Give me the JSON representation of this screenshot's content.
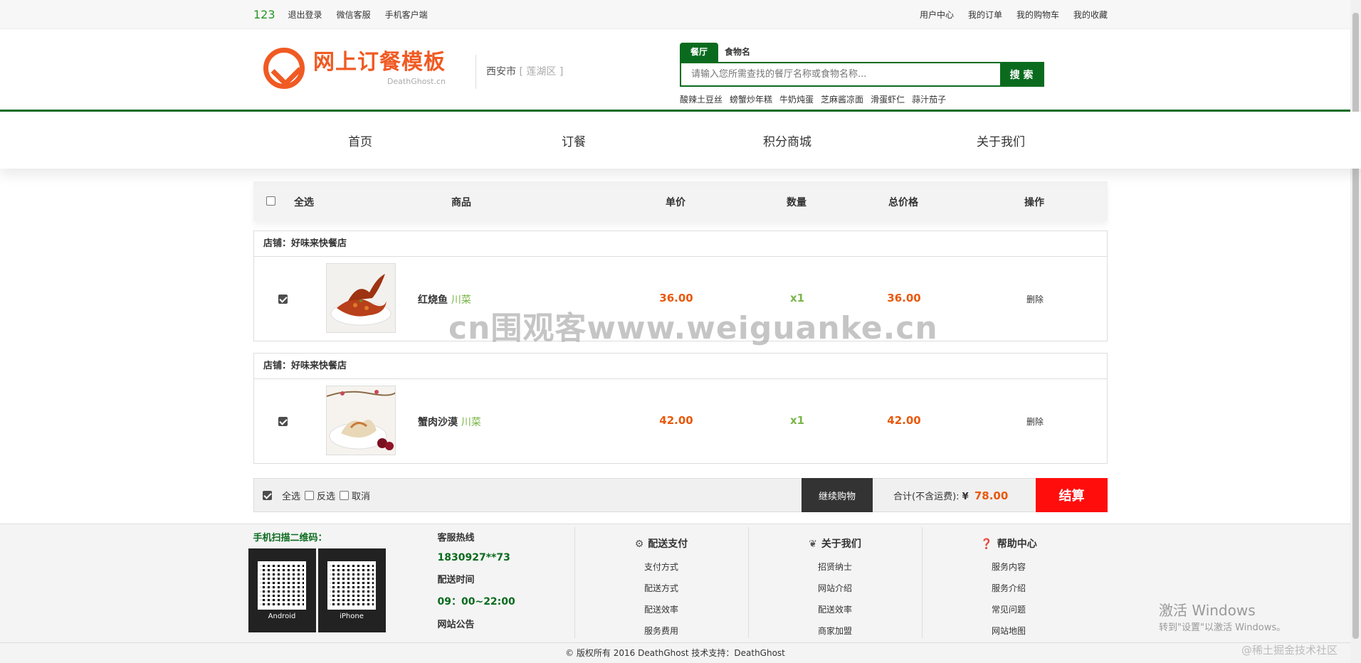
{
  "topbar": {
    "username": "123",
    "left_links": [
      "退出登录",
      "微信客服",
      "手机客户端"
    ],
    "right_links": [
      "用户中心",
      "我的订单",
      "我的购物车",
      "我的收藏"
    ]
  },
  "header": {
    "logo_cn": "网上订餐模板",
    "logo_en": "DeathGhost.cn",
    "city": "西安市",
    "district": "[ 莲湖区 ]",
    "search_tabs": [
      "餐厅",
      "食物名"
    ],
    "search_placeholder": "请输入您所需查找的餐厅名称或食物名称...",
    "search_button": "搜 索",
    "hot_keywords": [
      "酸辣土豆丝",
      "螃蟹炒年糕",
      "牛奶炖蛋",
      "芝麻酱凉面",
      "滑蛋虾仁",
      "蒜汁茄子"
    ]
  },
  "nav": [
    "首页",
    "订餐",
    "积分商城",
    "关于我们"
  ],
  "cart": {
    "headers": {
      "select_all": "全选",
      "product": "商品",
      "unit_price": "单价",
      "quantity": "数量",
      "total": "总价格",
      "action": "操作"
    },
    "shops": [
      {
        "title": "店铺：好味来快餐店",
        "item": {
          "name": "红烧鱼",
          "tag": "川菜",
          "price": "36.00",
          "qty": "x1",
          "total": "36.00",
          "action": "删除"
        }
      },
      {
        "title": "店铺：好味来快餐店",
        "item": {
          "name": "蟹肉沙漠",
          "tag": "川菜",
          "price": "42.00",
          "qty": "x1",
          "total": "42.00",
          "action": "删除"
        }
      }
    ],
    "footer": {
      "select_all": "全选",
      "invert": "反选",
      "cancel": "取消",
      "continue_button": "继续购物",
      "total_label": "合计(不含运费):",
      "currency": "¥",
      "total_amount": "78.00",
      "checkout_button": "结算"
    }
  },
  "watermark": "cn围观客www.weiguanke.cn",
  "footer": {
    "qr_title": "手机扫描二维码：",
    "qr_codes": [
      "Android",
      "iPhone"
    ],
    "hotline_title": "客服热线",
    "hotline": "1830927**73",
    "delivery_time_title": "配送时间",
    "delivery_time": "09：00~22:00",
    "notice_title": "网站公告",
    "columns": [
      {
        "title": "配送支付",
        "links": [
          "支付方式",
          "配送方式",
          "配送效率",
          "服务费用"
        ]
      },
      {
        "title": "关于我们",
        "links": [
          "招贤纳士",
          "网站介绍",
          "配送效率",
          "商家加盟"
        ]
      },
      {
        "title": "帮助中心",
        "links": [
          "服务内容",
          "服务介绍",
          "常见问题",
          "网站地图"
        ]
      }
    ],
    "copyright": "© 版权所有 2016 DeathGhost 技术支持：DeathGhost"
  },
  "overlay": {
    "activate_title": "激活 Windows",
    "activate_sub": "转到\"设置\"以激活 Windows。",
    "juejin": "@稀土掘金技术社区"
  }
}
